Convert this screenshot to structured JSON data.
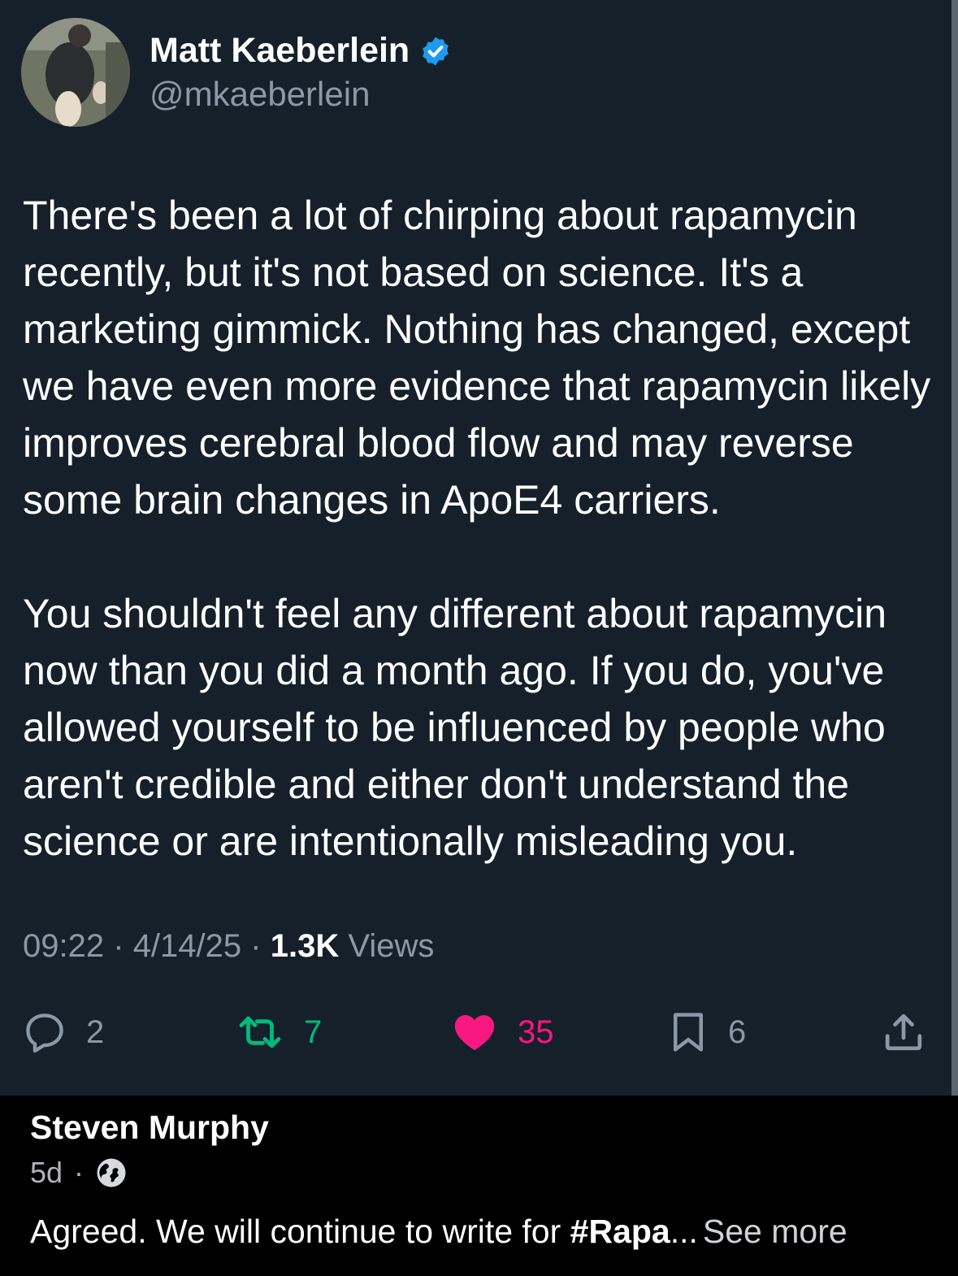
{
  "tweet": {
    "author_name": "Matt Kaeberlein",
    "handle": "@mkaeberlein",
    "paragraphs": [
      "There's been a lot of chirping about rapamycin recently, but it's not based on science. It's a marketing gimmick. Nothing has changed, except we have even more evidence that rapamycin likely improves cerebral blood flow and may reverse some brain changes in ApoE4 carriers.",
      "You shouldn't feel any different about rapamycin now than you did a month ago. If you do, you've allowed yourself to be influenced by people who aren't credible and either don't understand the science or are intentionally misleading you."
    ],
    "time": "09:22",
    "date": "4/14/25",
    "views_count": "1.3K",
    "views_label": "Views",
    "separator": "·",
    "actions": {
      "replies": "2",
      "retweets": "7",
      "likes": "35",
      "bookmarks": "6"
    },
    "icons": {
      "verified": "verified-badge-icon",
      "reply": "reply-icon",
      "retweet": "retweet-icon",
      "like": "heart-icon",
      "bookmark": "bookmark-icon",
      "share": "share-icon"
    },
    "colors": {
      "background": "#15202b",
      "verified": "#1d9bf0",
      "retweet": "#00ba7c",
      "like": "#f91880",
      "secondary_text": "#8b98a5"
    }
  },
  "comment": {
    "author_name": "Steven Murphy",
    "time": "5d",
    "separator": "·",
    "audience_icon": "globe-icon",
    "text_prefix": "Agreed. We will continue to write for ",
    "hashtag": "#Rapa",
    "ellipsis": "...",
    "see_more": "See more"
  }
}
